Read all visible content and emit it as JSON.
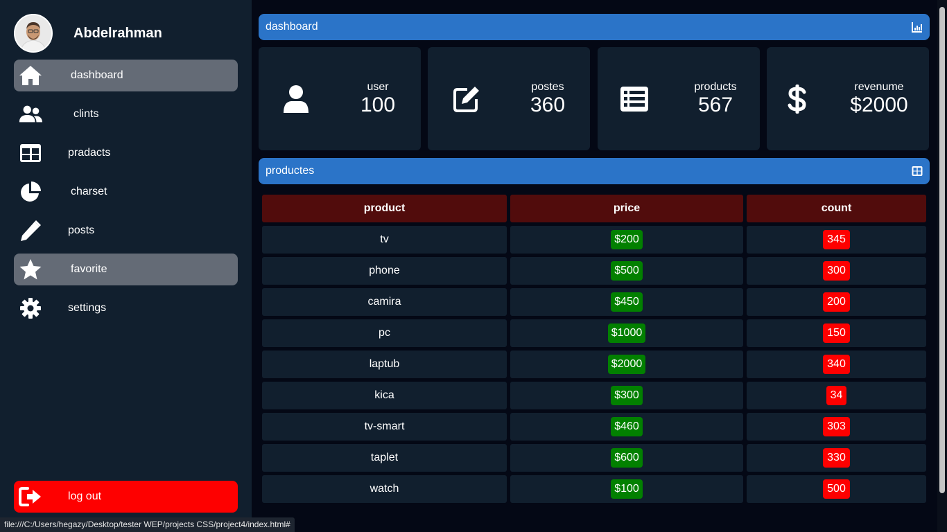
{
  "profile": {
    "name": "Abdelrahman"
  },
  "sidebar": {
    "items": [
      {
        "label": "dashboard",
        "icon": "home-icon"
      },
      {
        "label": "clints",
        "icon": "users-icon"
      },
      {
        "label": "pradacts",
        "icon": "table-icon"
      },
      {
        "label": "charset",
        "icon": "pie-chart-icon"
      },
      {
        "label": "posts",
        "icon": "pencil-icon"
      },
      {
        "label": "favorite",
        "icon": "star-icon"
      },
      {
        "label": "settings",
        "icon": "gear-icon"
      }
    ],
    "logout": "log out"
  },
  "dashboard_bar": {
    "title": "dashboard",
    "icon": "chart-icon"
  },
  "cards": [
    {
      "label": "user",
      "value": "100",
      "icon": "user-icon"
    },
    {
      "label": "postes",
      "value": "360",
      "icon": "edit-icon"
    },
    {
      "label": "products",
      "value": "567",
      "icon": "list-icon"
    },
    {
      "label": "revenume",
      "value": "$2000",
      "icon": "dollar-icon"
    }
  ],
  "products_bar": {
    "title": "productes",
    "icon": "grid-icon"
  },
  "table": {
    "headers": [
      "product",
      "price",
      "count"
    ],
    "rows": [
      [
        "tv",
        "$200",
        "345"
      ],
      [
        "phone",
        "$500",
        "300"
      ],
      [
        "camira",
        "$450",
        "200"
      ],
      [
        "pc",
        "$1000",
        "150"
      ],
      [
        "laptub",
        "$2000",
        "340"
      ],
      [
        "kica",
        "$300",
        "34"
      ],
      [
        "tv-smart",
        "$460",
        "303"
      ],
      [
        "taplet",
        "$600",
        "330"
      ],
      [
        "watch",
        "$100",
        "500"
      ]
    ]
  },
  "status_bar": "file:///C:/Users/hegazy/Desktop/tester WEP/projects CSS/project4/index.html#",
  "colors": {
    "sidebar_bg": "#111f2e",
    "page_bg": "#040815",
    "accent_blue": "#2b74c8",
    "active_nav": "#646b76",
    "logout_red": "#fe0000",
    "header_cell": "#510c0c",
    "price_green": "#028000",
    "count_red": "#fe0000"
  }
}
